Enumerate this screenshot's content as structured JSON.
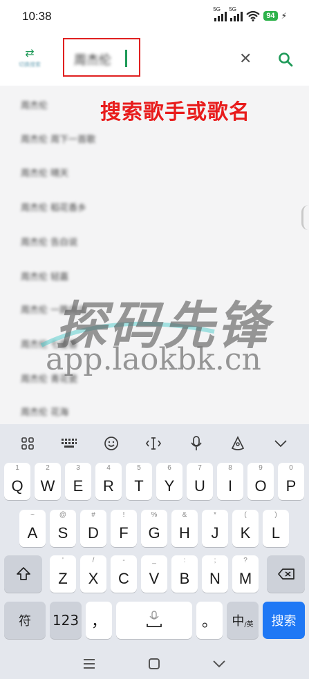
{
  "status": {
    "time": "10:38",
    "network1": "5G",
    "network2": "5G",
    "battery": "94"
  },
  "header": {
    "switch_label": "切换搜索",
    "search_value": "周杰伦",
    "clear_icon": "close-icon",
    "search_icon": "search-icon"
  },
  "banner": "搜索歌手或歌名",
  "suggestions": [
    "周杰伦",
    "周杰伦 周下一首歌",
    "周杰伦 晴天",
    "周杰伦 稻花香乡",
    "周杰伦 告白说",
    "周杰伦 轻嘉",
    "周杰伦 一路向北",
    "周杰伦 七里香",
    "周杰伦 青花瓷",
    "周杰伦 花海"
  ],
  "watermark": {
    "brand": "探码先锋",
    "url": "app.laokbk.cn"
  },
  "keyboard": {
    "toolbar_icons": [
      "grid-icon",
      "keyboard-icon",
      "emoji-icon",
      "cursor-icon",
      "mic-icon",
      "handwriting-icon",
      "chevron-down-icon"
    ],
    "row1": [
      {
        "k": "Q",
        "s": "1"
      },
      {
        "k": "W",
        "s": "2"
      },
      {
        "k": "E",
        "s": "3"
      },
      {
        "k": "R",
        "s": "4"
      },
      {
        "k": "T",
        "s": "5"
      },
      {
        "k": "Y",
        "s": "6"
      },
      {
        "k": "U",
        "s": "7"
      },
      {
        "k": "I",
        "s": "8"
      },
      {
        "k": "O",
        "s": "9"
      },
      {
        "k": "P",
        "s": "0"
      }
    ],
    "row2": [
      {
        "k": "A",
        "s": "~"
      },
      {
        "k": "S",
        "s": "@"
      },
      {
        "k": "D",
        "s": "#"
      },
      {
        "k": "F",
        "s": "!"
      },
      {
        "k": "G",
        "s": "%"
      },
      {
        "k": "H",
        "s": "&"
      },
      {
        "k": "J",
        "s": "*"
      },
      {
        "k": "K",
        "s": "("
      },
      {
        "k": "L",
        "s": ")"
      }
    ],
    "row3": [
      {
        "k": "Z",
        "s": "'"
      },
      {
        "k": "X",
        "s": "/"
      },
      {
        "k": "C",
        "s": "-"
      },
      {
        "k": "V",
        "s": "_"
      },
      {
        "k": "B",
        "s": ":"
      },
      {
        "k": "N",
        "s": ";"
      },
      {
        "k": "M",
        "s": "?"
      }
    ],
    "symbol_key": "符",
    "number_key": "123",
    "comma_key": "，",
    "period_key": "。",
    "lang_key": "中",
    "lang_sub": "/英",
    "enter_key": "搜索"
  }
}
